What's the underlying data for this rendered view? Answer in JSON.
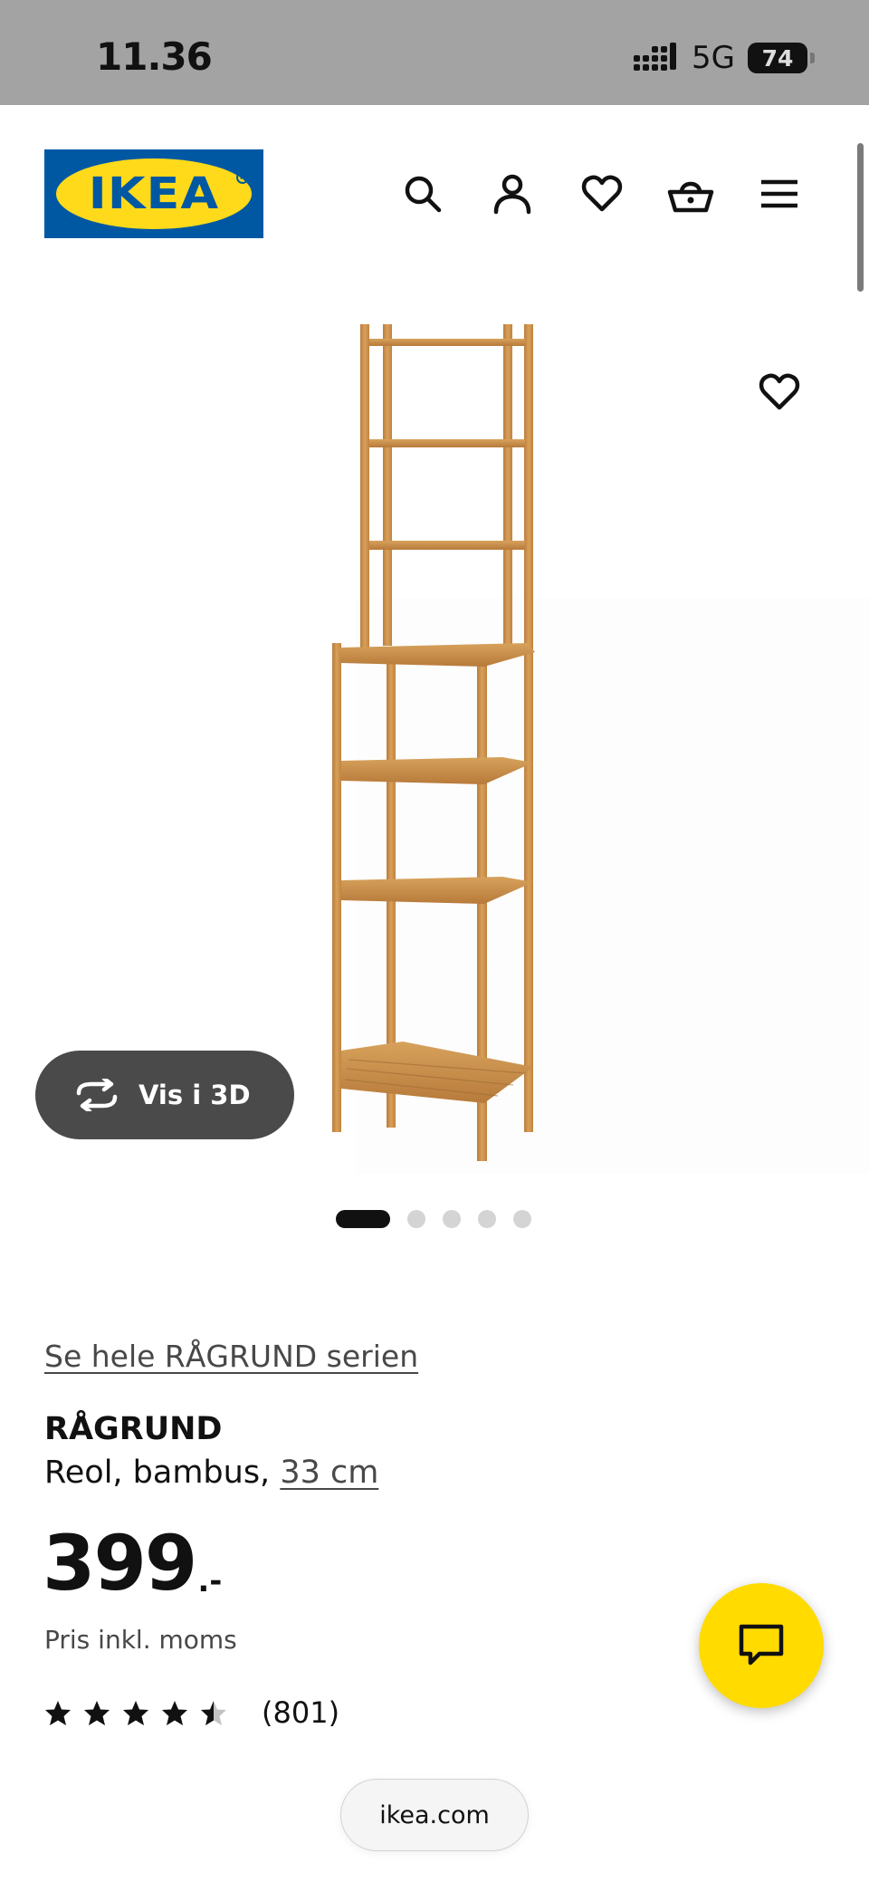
{
  "status_bar": {
    "time": "11.36",
    "network": "5G",
    "battery": "74"
  },
  "header": {
    "logo_text": "IKEA",
    "icons": [
      "search-icon",
      "account-icon",
      "heart-icon",
      "basket-icon",
      "menu-icon"
    ]
  },
  "gallery": {
    "view_3d_label": "Vis i 3D",
    "image_count": 5,
    "active_index": 0
  },
  "product": {
    "series_link": "Se hele RÅGRUND serien",
    "name": "RÅGRUND",
    "description": "Reol, bambus, ",
    "size_link": "33 cm",
    "price_integer": "399",
    "price_decimal": ".-",
    "price_note": "Pris inkl. moms",
    "rating_value": 4.5,
    "rating_max": 5,
    "rating_count": "(801)"
  },
  "browser": {
    "url": "ikea.com"
  },
  "colors": {
    "brand_blue": "#0058a3",
    "brand_yellow": "#ffda1a",
    "chat_yellow": "#ffdb00",
    "pill_dark": "#4a4a4a"
  }
}
